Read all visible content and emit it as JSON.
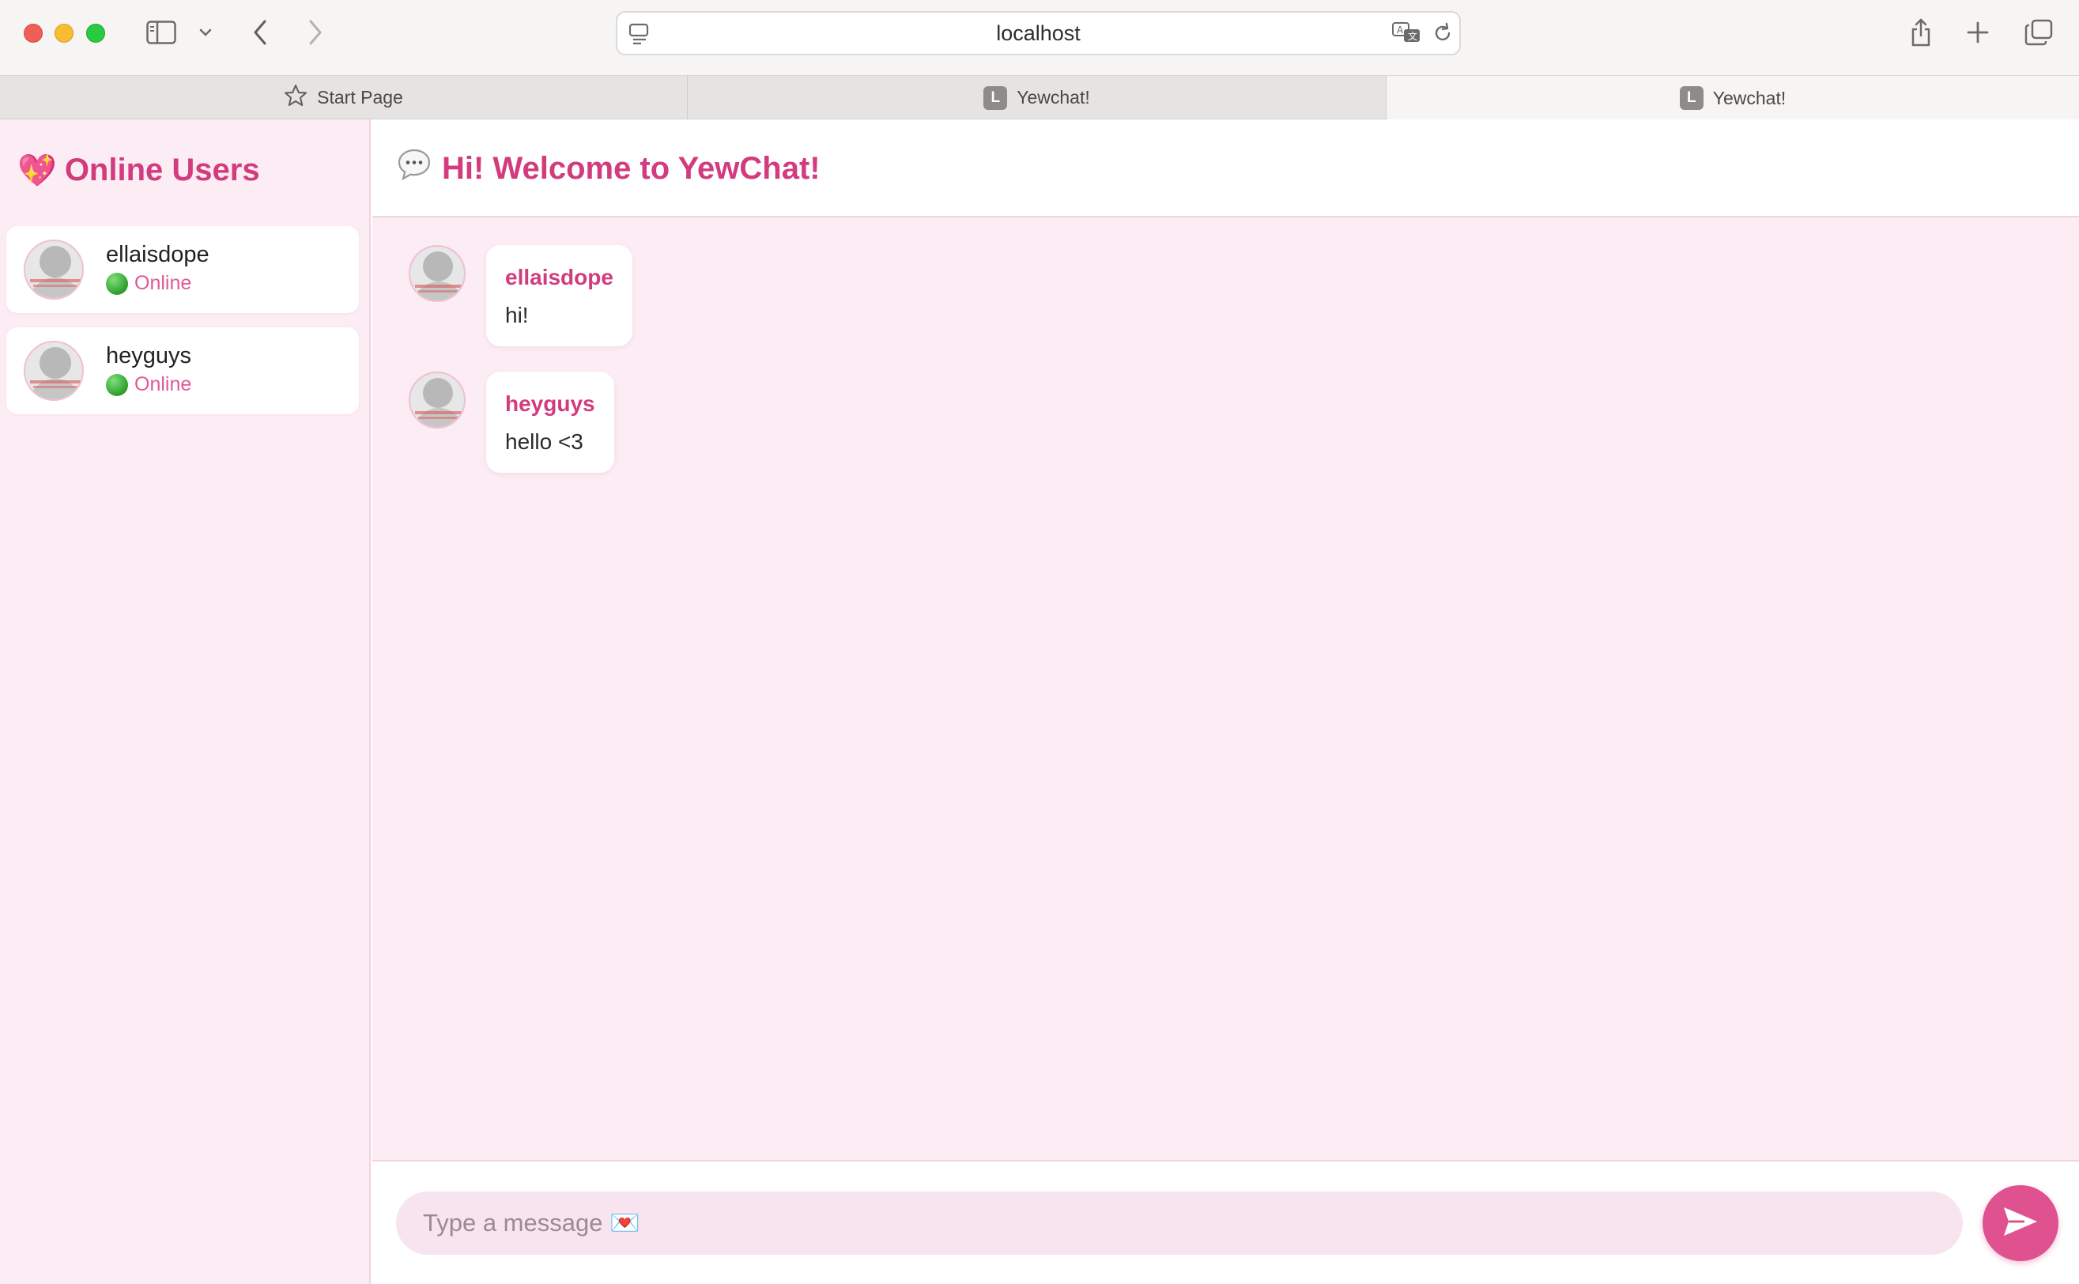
{
  "browser": {
    "url": "localhost",
    "tabs": [
      {
        "label": "Start Page",
        "favicon": "star-icon"
      },
      {
        "label": "Yewchat!",
        "favicon": "L"
      },
      {
        "label": "Yewchat!",
        "favicon": "L"
      }
    ],
    "active_tab": 2
  },
  "sidebar": {
    "title_emoji": "💖",
    "title": "Online Users",
    "users": [
      {
        "name": "ellaisdope",
        "status": "Online"
      },
      {
        "name": "heyguys",
        "status": "Online"
      }
    ]
  },
  "chat": {
    "title_icon": "speech-bubble-icon",
    "title": "Hi! Welcome to YewChat!",
    "messages": [
      {
        "author": "ellaisdope",
        "text": "hi!"
      },
      {
        "author": "heyguys",
        "text": "hello <3"
      }
    ],
    "composer": {
      "placeholder": "Type a message 💌",
      "value": ""
    }
  },
  "colors": {
    "accent": "#d23b7e",
    "send_button": "#e0518f",
    "background": "#fcecf3"
  }
}
